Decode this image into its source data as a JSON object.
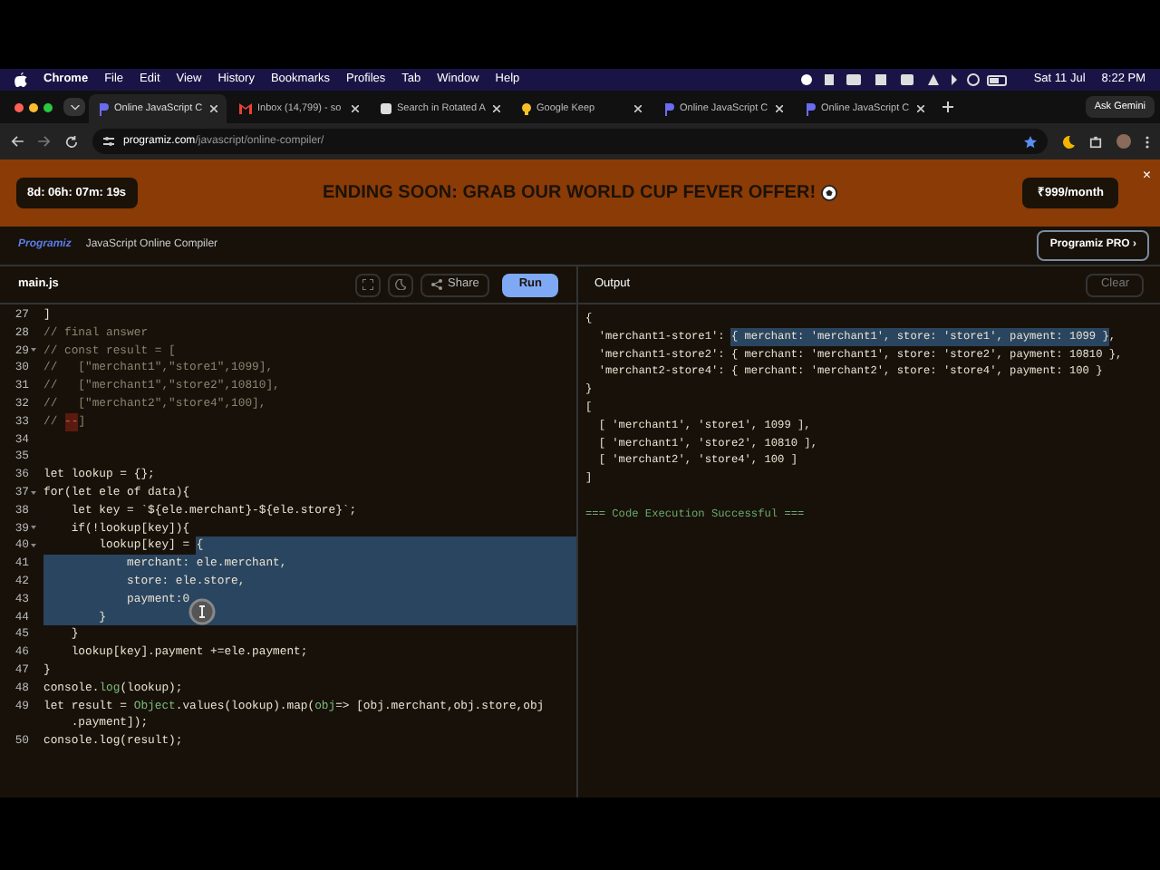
{
  "menu_bar": {
    "app": "Chrome",
    "items": [
      "File",
      "Edit",
      "View",
      "History",
      "Bookmarks",
      "Profiles",
      "Tab",
      "Window",
      "Help"
    ],
    "date": "Sat 11 Jul",
    "time": "8:22 PM"
  },
  "tabs": [
    {
      "title": "Online JavaScript C",
      "selected": true
    },
    {
      "title": "Inbox (14,799) - so",
      "selected": false
    },
    {
      "title": "Search in Rotated A",
      "selected": false
    },
    {
      "title": "Google Keep",
      "selected": false
    },
    {
      "title": "Online JavaScript C",
      "selected": false
    },
    {
      "title": "Online JavaScript C",
      "selected": false
    }
  ],
  "ask_button": "Ask Gemini",
  "address": {
    "domain": "programiz.com",
    "path": "/javascript/online-compiler/"
  },
  "banner": {
    "timer": "8d: 06h: 07m: 19s",
    "headline": "ENDING SOON: **GRAB OUR WORLD CUP FEVER OFFER!**",
    "price": "₹999/month",
    "close": "×"
  },
  "header": {
    "logo": "Programiz",
    "title": "JavaScript Online Compiler",
    "pro_button": "Programiz PRO ›"
  },
  "toolbar": {
    "file": "main.js",
    "share": "Share",
    "run": "Run",
    "output": "Output",
    "clear": "Clear"
  },
  "code_lines": [
    {
      "kind": "line",
      "number": "27",
      "fold": false,
      "segments": [
        {
          "text": "]",
          "kind": "plain",
          "selected": false
        }
      ]
    },
    {
      "kind": "line",
      "number": "28",
      "fold": false,
      "segments": [
        {
          "text": "// final answer",
          "kind": "comment",
          "selected": false
        }
      ]
    },
    {
      "kind": "line",
      "number": "29",
      "fold": true,
      "segments": [
        {
          "text": "// const result = [",
          "kind": "comment",
          "selected": false
        }
      ]
    },
    {
      "kind": "line",
      "number": "30",
      "fold": false,
      "segments": [
        {
          "text": "//   [\"merchant1\",\"store1\",1099],",
          "kind": "comment",
          "selected": false
        }
      ]
    },
    {
      "kind": "line",
      "number": "31",
      "fold": false,
      "segments": [
        {
          "text": "//   [\"merchant1\",\"store2\",10810],",
          "kind": "comment",
          "selected": false
        }
      ]
    },
    {
      "kind": "line",
      "number": "32",
      "fold": false,
      "segments": [
        {
          "text": "//   [\"merchant2\",\"store4\",100],",
          "kind": "comment",
          "selected": false
        }
      ]
    },
    {
      "kind": "line",
      "number": "33",
      "fold": false,
      "segments": [
        {
          "text": "// ",
          "kind": "comment",
          "selected": false
        },
        {
          "text": "--",
          "kind": "error",
          "selected": false
        },
        {
          "text": "]",
          "kind": "comment",
          "selected": false
        }
      ]
    },
    {
      "kind": "line",
      "number": "34",
      "fold": false
    },
    {
      "kind": "line",
      "number": "35",
      "fold": false
    },
    {
      "kind": "line",
      "number": "36",
      "fold": false,
      "segments": [
        {
          "text": "let lookup = {};",
          "kind": "plain",
          "selected": false
        }
      ]
    },
    {
      "kind": "line",
      "number": "37",
      "fold": true,
      "segments": [
        {
          "text": "for(let ele of data){",
          "kind": "plain",
          "selected": false
        }
      ]
    },
    {
      "kind": "line",
      "number": "38",
      "fold": false,
      "segments": [
        {
          "text": "    let key = `${ele.merchant}-${ele.store}`;",
          "kind": "plain",
          "selected": false
        }
      ]
    },
    {
      "kind": "line",
      "number": "39",
      "fold": true,
      "segments": [
        {
          "text": "    if(!lookup[key]){",
          "kind": "plain",
          "selected": false
        }
      ]
    },
    {
      "kind": "line",
      "number": "40",
      "fold": true,
      "segments": [
        {
          "text": "        lookup[key] = ",
          "kind": "plain",
          "selected": false
        },
        {
          "text": "{",
          "kind": "plain",
          "selected": true
        }
      ]
    },
    {
      "kind": "line",
      "number": "41",
      "fold": false,
      "segments": [
        {
          "text": "            merchant: ele.merchant,",
          "kind": "plain",
          "selected": true
        }
      ]
    },
    {
      "kind": "line",
      "number": "42",
      "fold": false,
      "segments": [
        {
          "text": "            store: ele.store,",
          "kind": "plain",
          "selected": true
        }
      ]
    },
    {
      "kind": "line",
      "number": "43",
      "fold": false,
      "segments": [
        {
          "text": "            payment:0",
          "kind": "plain",
          "selected": true
        }
      ]
    },
    {
      "kind": "line",
      "number": "44",
      "fold": false,
      "segments": [
        {
          "text": "        }",
          "kind": "plain",
          "selected": true
        }
      ]
    },
    {
      "kind": "line",
      "number": "45",
      "fold": false,
      "segments": [
        {
          "text": "    }",
          "kind": "plain",
          "selected": false
        }
      ]
    },
    {
      "kind": "line",
      "number": "46",
      "fold": false,
      "segments": [
        {
          "text": "    lookup[key].payment +=ele.payment;",
          "kind": "plain",
          "selected": false
        }
      ]
    },
    {
      "kind": "line",
      "number": "47",
      "fold": false,
      "segments": [
        {
          "text": "}",
          "kind": "plain",
          "selected": false
        }
      ]
    },
    {
      "kind": "line",
      "number": "48",
      "fold": false,
      "segments": [
        {
          "text": "console.",
          "kind": "plain",
          "selected": false
        },
        {
          "text": "log",
          "kind": "builtin",
          "selected": false
        },
        {
          "text": "(lookup);",
          "kind": "plain",
          "selected": false
        }
      ]
    },
    {
      "kind": "line",
      "number": "49",
      "fold": false,
      "segments": [
        {
          "text": "let result = ",
          "kind": "plain",
          "selected": false
        },
        {
          "text": "Object",
          "kind": "builtin",
          "selected": false
        },
        {
          "text": ".values(lookup).map(",
          "kind": "plain",
          "selected": false
        },
        {
          "text": "obj",
          "kind": "builtin",
          "selected": false
        },
        {
          "text": "=> [obj.merchant,obj.store,obj",
          "kind": "plain",
          "selected": false
        }
      ]
    },
    {
      "kind": "continuation",
      "segments": [
        {
          "text": "    .payment]);",
          "kind": "plain",
          "selected": false
        }
      ]
    },
    {
      "kind": "line",
      "number": "50",
      "fold": false,
      "segments": [
        {
          "text": "console.log(result);",
          "kind": "plain",
          "selected": false
        }
      ]
    }
  ],
  "output_lines": [
    {
      "segments": [
        {
          "text": "{",
          "kind": "plain",
          "selected": false
        }
      ]
    },
    {
      "segments": [
        {
          "text": "  'merchant1-store1': ",
          "kind": "plain",
          "selected": false
        },
        {
          "text": "{ merchant: 'merchant1', store: 'store1', payment: 1099 }",
          "kind": "plain",
          "selected": true
        },
        {
          "text": ",",
          "kind": "plain",
          "selected": false
        }
      ]
    },
    {
      "segments": [
        {
          "text": "  'merchant1-store2': { merchant: 'merchant1', store: 'store2', payment: 10810 },",
          "kind": "plain",
          "selected": false
        }
      ]
    },
    {
      "segments": [
        {
          "text": "  'merchant2-store4': { merchant: 'merchant2', store: 'store4', payment: 100 }",
          "kind": "plain",
          "selected": false
        }
      ]
    },
    {
      "segments": [
        {
          "text": "}",
          "kind": "plain",
          "selected": false
        }
      ]
    },
    {
      "segments": [
        {
          "text": "[",
          "kind": "plain",
          "selected": false
        }
      ]
    },
    {
      "segments": [
        {
          "text": "  [ 'merchant1', 'store1', 1099 ],",
          "kind": "plain",
          "selected": false
        }
      ]
    },
    {
      "segments": [
        {
          "text": "  [ 'merchant1', 'store2', 10810 ],",
          "kind": "plain",
          "selected": false
        }
      ]
    },
    {
      "segments": [
        {
          "text": "  [ 'merchant2', 'store4', 100 ]",
          "kind": "plain",
          "selected": false
        }
      ]
    },
    {
      "segments": [
        {
          "text": "]",
          "kind": "plain",
          "selected": false
        }
      ]
    },
    {
      "kind": "blank"
    },
    {
      "segments": [
        {
          "text": "=== Code Execution Successful ===",
          "kind": "success",
          "selected": false
        }
      ]
    }
  ]
}
